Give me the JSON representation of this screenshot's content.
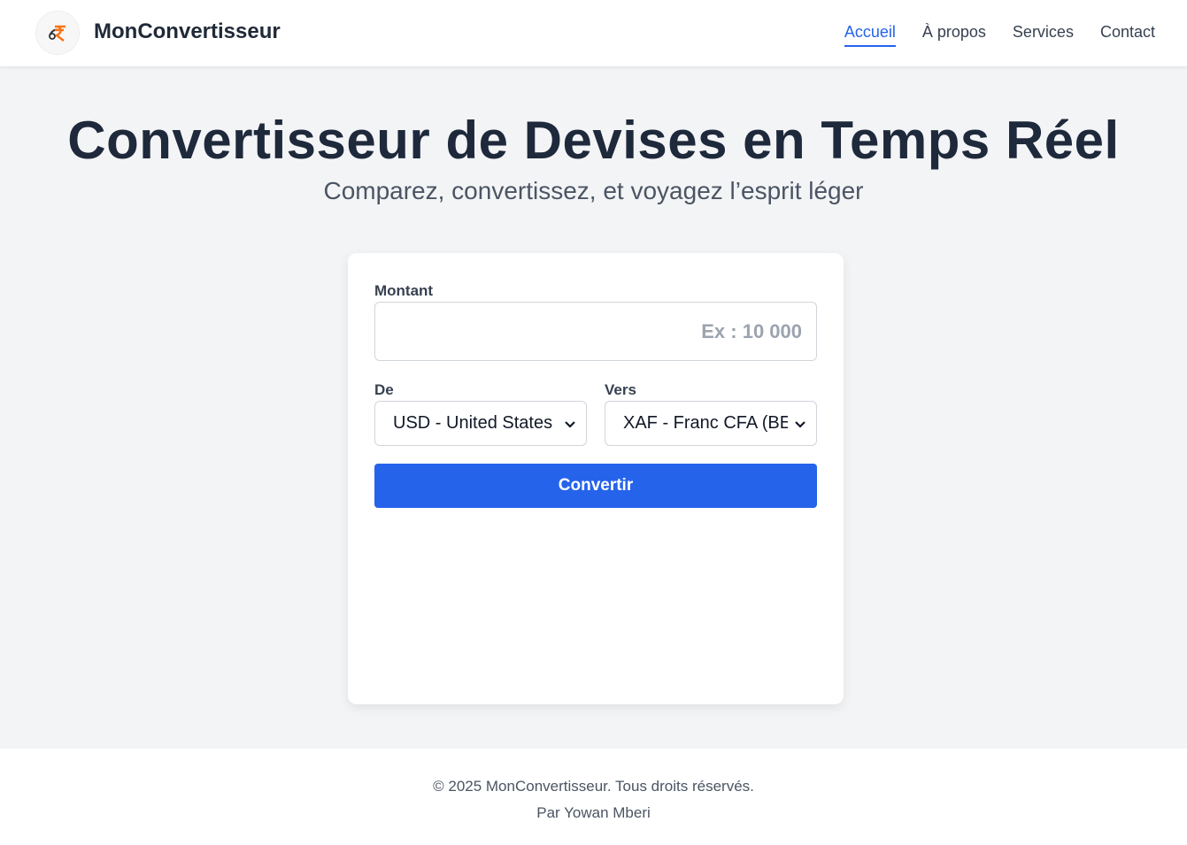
{
  "header": {
    "brand": "MonConvertisseur",
    "nav": [
      {
        "label": "Accueil",
        "active": true
      },
      {
        "label": "À propos",
        "active": false
      },
      {
        "label": "Services",
        "active": false
      },
      {
        "label": "Contact",
        "active": false
      }
    ]
  },
  "hero": {
    "title": "Convertisseur de Devises en Temps Réel",
    "subtitle": "Comparez, convertissez, et voyagez l’esprit léger"
  },
  "form": {
    "amount_label": "Montant",
    "amount_placeholder": "Ex : 10 000",
    "amount_value": "",
    "from_label": "De",
    "from_selected": "USD - United States Dollar",
    "to_label": "Vers",
    "to_selected": "XAF - Franc CFA (BEAC)",
    "convert_label": "Convertir"
  },
  "footer": {
    "copyright": "© 2025 MonConvertisseur. Tous droits réservés.",
    "author": "Par Yowan Mberi"
  },
  "colors": {
    "accent": "#2563eb",
    "background": "#f3f4f6",
    "heading": "#1e293b"
  }
}
